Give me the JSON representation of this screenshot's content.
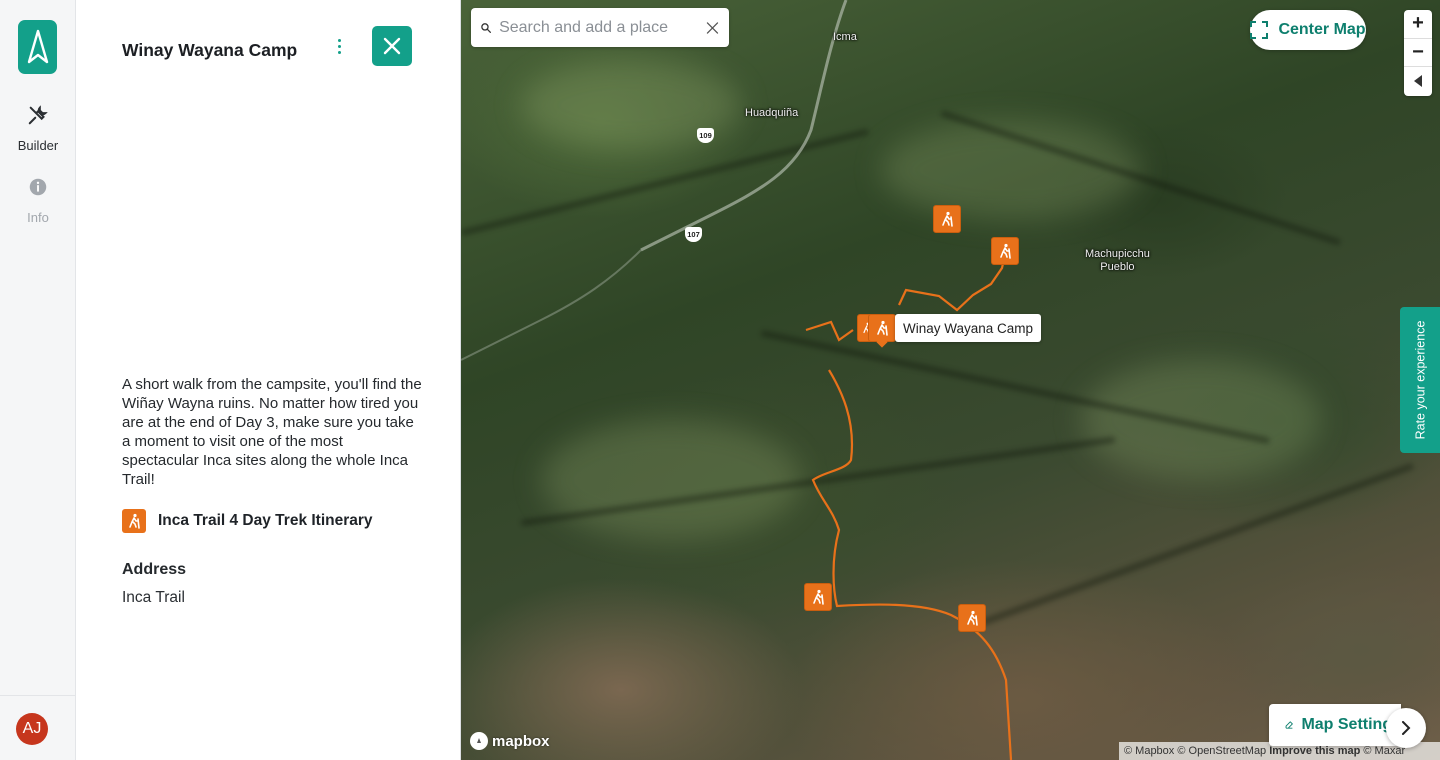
{
  "rail": {
    "builder_label": "Builder",
    "info_label": "Info",
    "avatar_initials": "AJ"
  },
  "panel": {
    "title": "Winay Wayana Camp",
    "description": "A short walk from the campsite, you'll find the Wiñay Wayna ruins. No matter how tired you are at the end of Day 3, make sure you take a moment to visit one of the most spectacular Inca sites along the whole Inca Trail!",
    "itinerary_label": "Inca Trail 4 Day Trek Itinerary",
    "address_heading": "Address",
    "address_value": "Inca Trail"
  },
  "map": {
    "search_placeholder": "Search and add a place",
    "center_map_label": "Center Map",
    "zoom_in": "+",
    "zoom_out": "−",
    "rate_label": "Rate your experience",
    "tooltip_label": "Winay Wayana Camp",
    "places": {
      "icma": "Icma",
      "huadquina": "Huadquiña",
      "machupicchu_line1": "Machupicchu",
      "machupicchu_line2": "Pueblo"
    },
    "road_shields": {
      "r109": "109",
      "r107": "107"
    },
    "logo_text": "mapbox",
    "attribution": {
      "mapbox": "© Mapbox",
      "osm": "© OpenStreetMap",
      "improve": "Improve this map",
      "maxar": "© Maxar"
    },
    "map_settings_label": "Map Settings"
  },
  "colors": {
    "brand": "#13a08a",
    "marker": "#e8711a",
    "avatar": "#c6361d"
  }
}
